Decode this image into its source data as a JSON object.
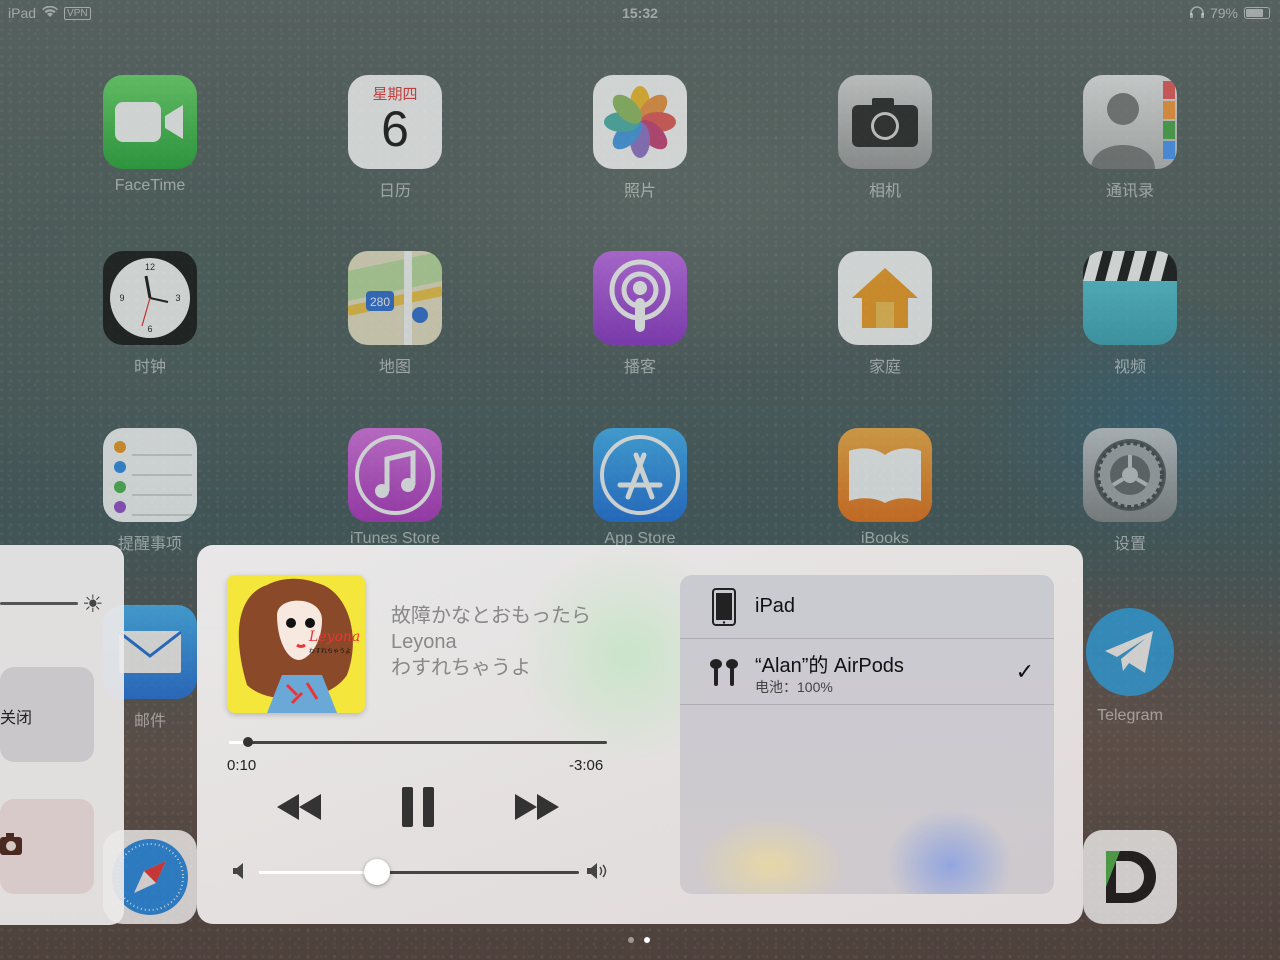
{
  "status_bar": {
    "device": "iPad",
    "vpn": "VPN",
    "time": "15:32",
    "battery": "79%",
    "battery_level": 0.79
  },
  "apps": [
    {
      "label": "FaceTime",
      "icon": "facetime-icon"
    },
    {
      "label": "日历",
      "icon": "calendar-icon",
      "weekday": "星期四",
      "day": "6"
    },
    {
      "label": "照片",
      "icon": "photos-icon"
    },
    {
      "label": "相机",
      "icon": "camera-icon"
    },
    {
      "label": "通讯录",
      "icon": "contacts-icon"
    },
    {
      "label": "时钟",
      "icon": "clock-icon"
    },
    {
      "label": "地图",
      "icon": "maps-icon",
      "road": "280"
    },
    {
      "label": "播客",
      "icon": "podcasts-icon"
    },
    {
      "label": "家庭",
      "icon": "home-icon"
    },
    {
      "label": "视频",
      "icon": "videos-icon"
    },
    {
      "label": "提醒事项",
      "icon": "reminders-icon"
    },
    {
      "label": "iTunes Store",
      "icon": "itunes-icon"
    },
    {
      "label": "App Store",
      "icon": "appstore-icon"
    },
    {
      "label": "iBooks",
      "icon": "ibooks-icon"
    },
    {
      "label": "设置",
      "icon": "settings-icon"
    },
    {
      "label": "邮件",
      "icon": "mail-icon"
    },
    {
      "label": "Telegram",
      "icon": "telegram-icon"
    }
  ],
  "control_center": {
    "left_panel": {
      "toggle_label": "关闭"
    },
    "now_playing": {
      "album_art_text": "Leyona",
      "album_art_subtext": "わすれちゃうよ",
      "title": "故障かなとおもったら",
      "artist": "Leyona",
      "album": "わすれちゃうよ",
      "elapsed": "0:10",
      "remaining": "-3:06",
      "progress": 0.05,
      "volume": 0.37
    },
    "audio_devices": [
      {
        "name": "iPad",
        "icon": "ipad-icon",
        "selected": false
      },
      {
        "name": "“Alan”的 AirPods",
        "icon": "airpods-icon",
        "battery": "电池：100%",
        "selected": true
      }
    ]
  },
  "colors": {
    "facetime": "#3cb34a",
    "photos_bg": "#ffffff",
    "podcasts": "#9a3fd0",
    "itunes": "#c43acb",
    "appstore": "#1a8ef0",
    "ibooks": "#f08a18",
    "telegram": "#2a9fe0",
    "mail": "#1f7de6"
  }
}
